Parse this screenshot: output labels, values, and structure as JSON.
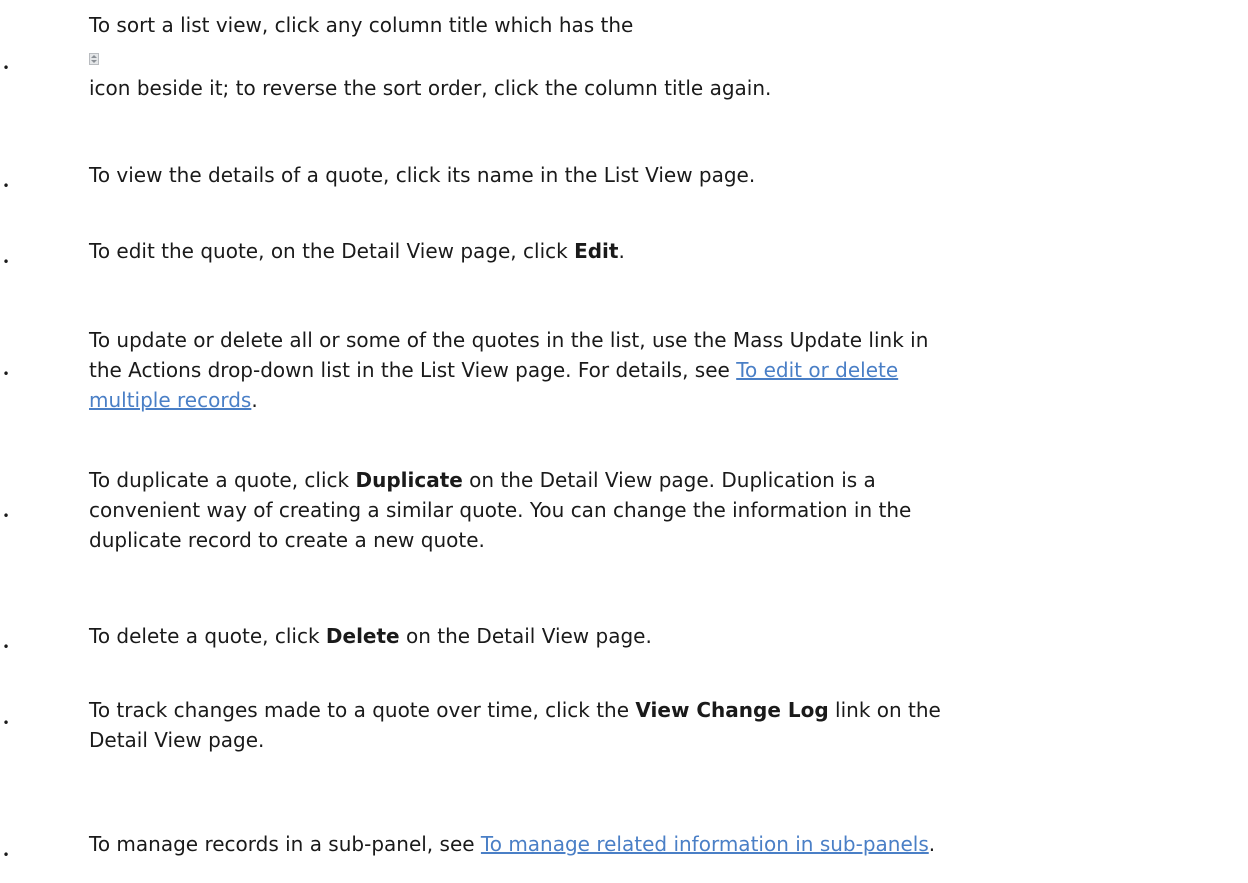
{
  "items": [
    {
      "part1": "To sort a list view, click any column title which has the",
      "icon": "sort-icon",
      "part2": "icon beside it; to reverse the sort order, click the column title again."
    },
    {
      "text": "To view the details of a quote, click its name in the List View page."
    },
    {
      "before": "To edit the quote, on the Detail View page, click ",
      "bold": "Edit",
      "after": "."
    },
    {
      "line1": "To update or delete all or some of the quotes in the list, use the Mass Update link in",
      "line2_before": "the Actions drop-down list in the List View page. For details, see ",
      "link_part1": "To edit or delete",
      "link_part2": "multiple records",
      "after": "."
    },
    {
      "before": "To duplicate a quote, click ",
      "bold": "Duplicate",
      "after_line1": " on the Detail View page. Duplication is a",
      "line2": "convenient way of creating a similar quote. You can change the information in the",
      "line3": "duplicate record to create a new quote."
    },
    {
      "before": "To delete a quote, click ",
      "bold": "Delete",
      "after": " on the Detail View page."
    },
    {
      "before": "To track changes made to a quote over time, click the ",
      "bold": "View Change Log",
      "after_line1": " link on the",
      "line2": "Detail View page."
    },
    {
      "before": "To manage records in a sub-panel, see ",
      "link": "To manage related information in sub-panels",
      "after": "."
    }
  ],
  "bullet_char": "•",
  "colors": {
    "text": "#1a1a1a",
    "link": "#4a7fc6",
    "background": "#ffffff"
  }
}
